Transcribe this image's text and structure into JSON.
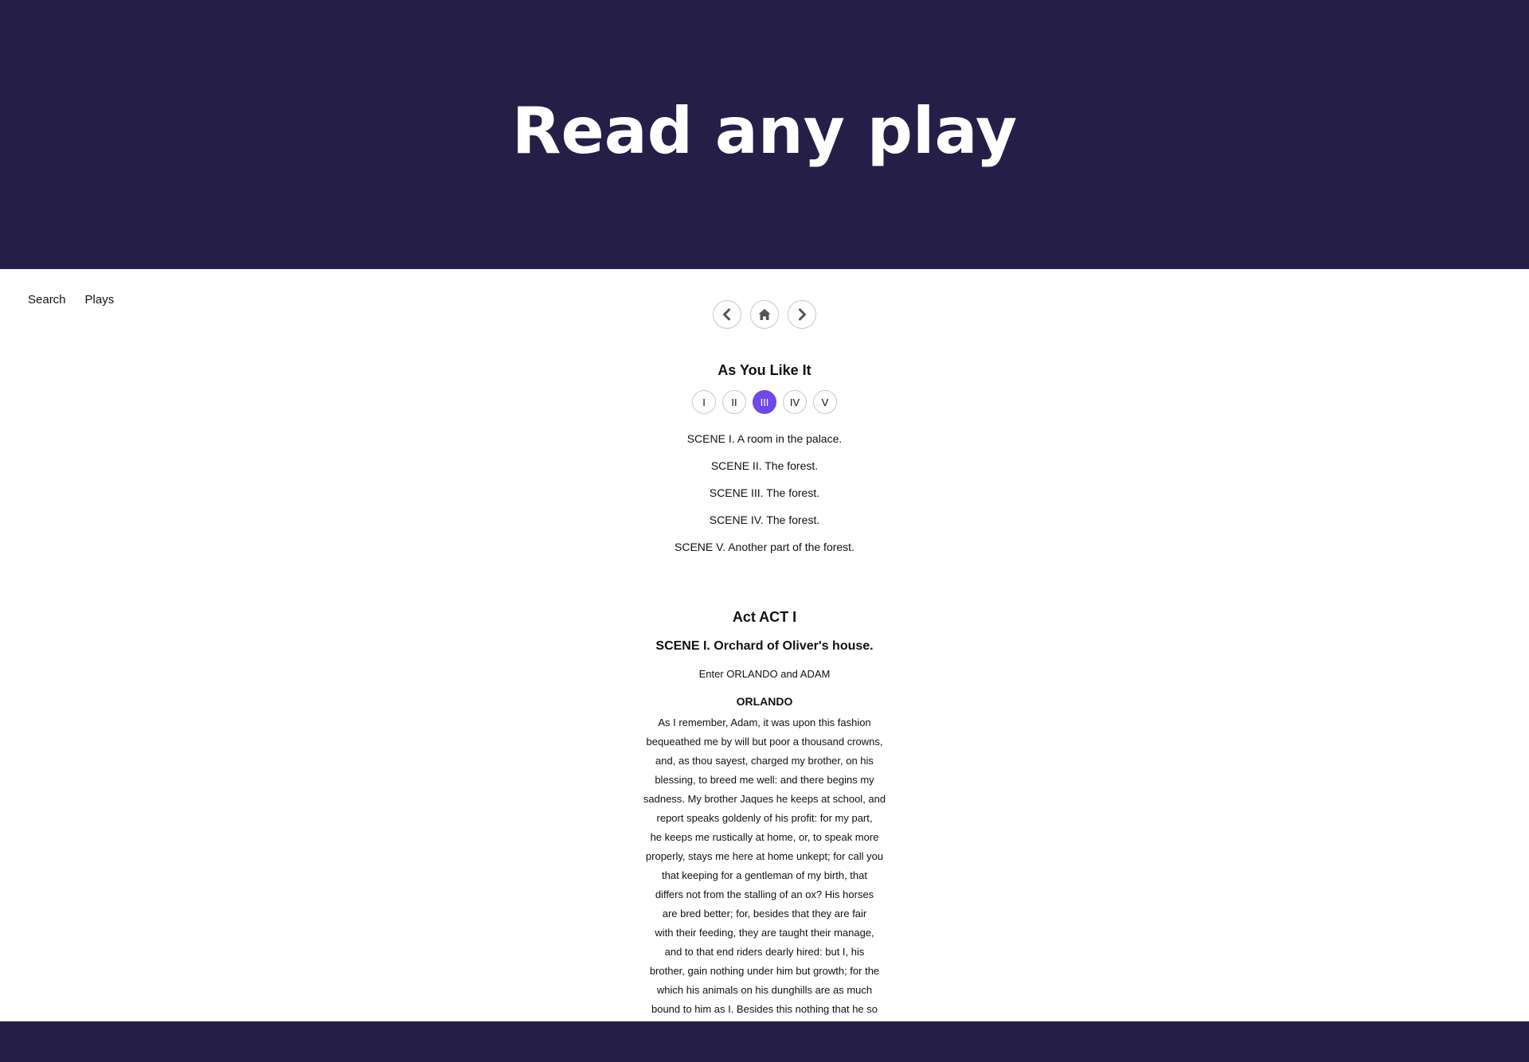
{
  "hero": {
    "title": "Read any play"
  },
  "topnav": {
    "search_label": "Search",
    "plays_label": "Plays"
  },
  "nav_buttons": {
    "prev_icon": "chevron-left-icon",
    "home_icon": "home-icon",
    "next_icon": "chevron-right-icon"
  },
  "play": {
    "title": "As You Like It",
    "acts": [
      "I",
      "II",
      "III",
      "IV",
      "V"
    ],
    "selected_act": "III",
    "scenes": [
      "SCENE I. A room in the palace.",
      "SCENE II. The forest.",
      "SCENE III. The forest.",
      "SCENE IV. The forest.",
      "SCENE V. Another part of the forest."
    ]
  },
  "text": {
    "act_heading": "Act ACT I",
    "scene_heading": "SCENE I. Orchard of Oliver's house.",
    "stage_direction": "Enter ORLANDO and ADAM",
    "speaker": "ORLANDO",
    "speech_lines": [
      "As I remember, Adam, it was upon this fashion",
      "bequeathed me by will but poor a thousand crowns,",
      "and, as thou sayest, charged my brother, on his",
      "blessing, to breed me well: and there begins my",
      "sadness. My brother Jaques he keeps at school, and",
      "report speaks goldenly of his profit: for my part,",
      "he keeps me rustically at home, or, to speak more",
      "properly, stays me here at home unkept; for call you",
      "that keeping for a gentleman of my birth, that",
      "differs not from the stalling of an ox? His horses",
      "are bred better; for, besides that they are fair",
      "with their feeding, they are taught their manage,",
      "and to that end riders dearly hired: but I, his",
      "brother, gain nothing under him but growth; for the",
      "which his animals on his dunghills are as much",
      "bound to him as I. Besides this nothing that he so"
    ]
  },
  "colors": {
    "header_bg": "#251f47",
    "accent": "#7048e8"
  }
}
